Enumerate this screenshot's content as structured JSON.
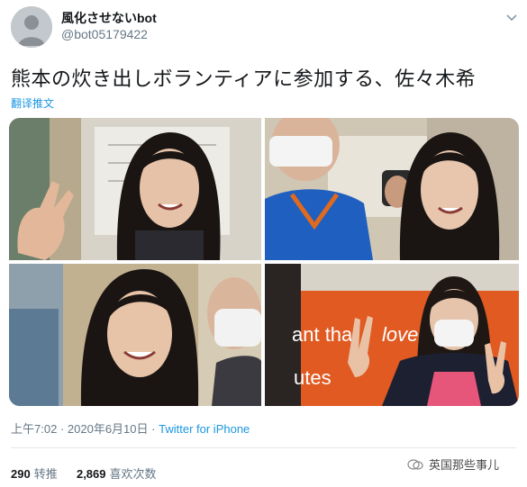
{
  "account": {
    "display_name": "風化させないbot",
    "handle": "@bot05179422"
  },
  "tweet": {
    "text": "熊本の炊き出しボランティアに参加する、佐々木希",
    "translate_link": "翻译推文",
    "time": "上午7:02",
    "date": "2020年6月10日",
    "separator": "·",
    "source": "Twitter for iPhone"
  },
  "stats": {
    "retweets_count": "290",
    "retweets_label": "转推",
    "likes_count": "2,869",
    "likes_label": "喜欢次数"
  },
  "media": {
    "photo_count": 4,
    "sign_text_1": "ant tha",
    "sign_text_2": "loved",
    "sign_text_3": "utes"
  },
  "watermark": {
    "text": "英国那些事儿",
    "icon": "wechat-icon"
  },
  "colors": {
    "link": "#1b95e0",
    "secondary_text": "#657786",
    "primary_text": "#14171a"
  }
}
